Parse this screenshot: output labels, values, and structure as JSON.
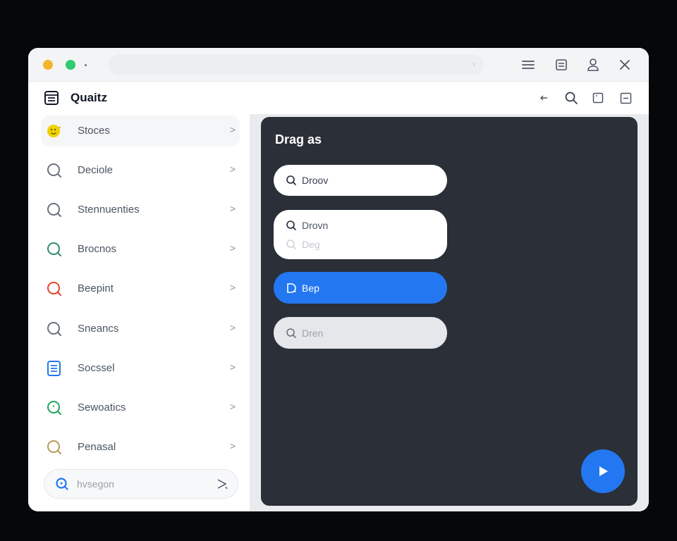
{
  "app": {
    "name": "Quaitz",
    "logo_icon": "document-list-icon"
  },
  "titlebar": {
    "controls": [
      "menu-icon",
      "note-icon",
      "user-icon",
      "close-icon"
    ]
  },
  "header": {
    "icons": [
      "back-arrow-icon",
      "search-icon",
      "square-icon",
      "minus-square-icon"
    ]
  },
  "sidebar": {
    "items": [
      {
        "label": "Stoces",
        "icon": "face-icon",
        "color": "#e6c700"
      },
      {
        "label": "Deciole",
        "icon": "search-icon",
        "color": "#6b7280"
      },
      {
        "label": "Stennuenties",
        "icon": "search-icon",
        "color": "#6b7280"
      },
      {
        "label": "Brocnos",
        "icon": "search-icon",
        "color": "#2f8f6b"
      },
      {
        "label": "Beepint",
        "icon": "search-icon",
        "color": "#e0452b"
      },
      {
        "label": "Sneancs",
        "icon": "search-icon",
        "color": "#6b7280"
      },
      {
        "label": "Socssel",
        "icon": "document-icon",
        "color": "#2377f1"
      },
      {
        "label": "Sewoatics",
        "icon": "search-icon",
        "color": "#23a55a"
      },
      {
        "label": "Penasal",
        "icon": "search-icon",
        "color": "#b89a58"
      }
    ],
    "search": {
      "placeholder": "hvsegon",
      "icon": "search-icon",
      "send_icon": "send-icon"
    }
  },
  "panel": {
    "title": "Drag as",
    "cards": [
      {
        "lines": [
          "Droov"
        ],
        "style": "white"
      },
      {
        "lines": [
          "Drovn",
          "Deg"
        ],
        "style": "white"
      },
      {
        "lines": [
          "Bep"
        ],
        "style": "blue"
      },
      {
        "lines": [
          "Dren"
        ],
        "style": "grey"
      }
    ],
    "fab_icon": "play-icon"
  },
  "colors": {
    "accent": "#2377f1",
    "panel_bg": "#2a2f38",
    "window_bg": "#ffffff"
  }
}
